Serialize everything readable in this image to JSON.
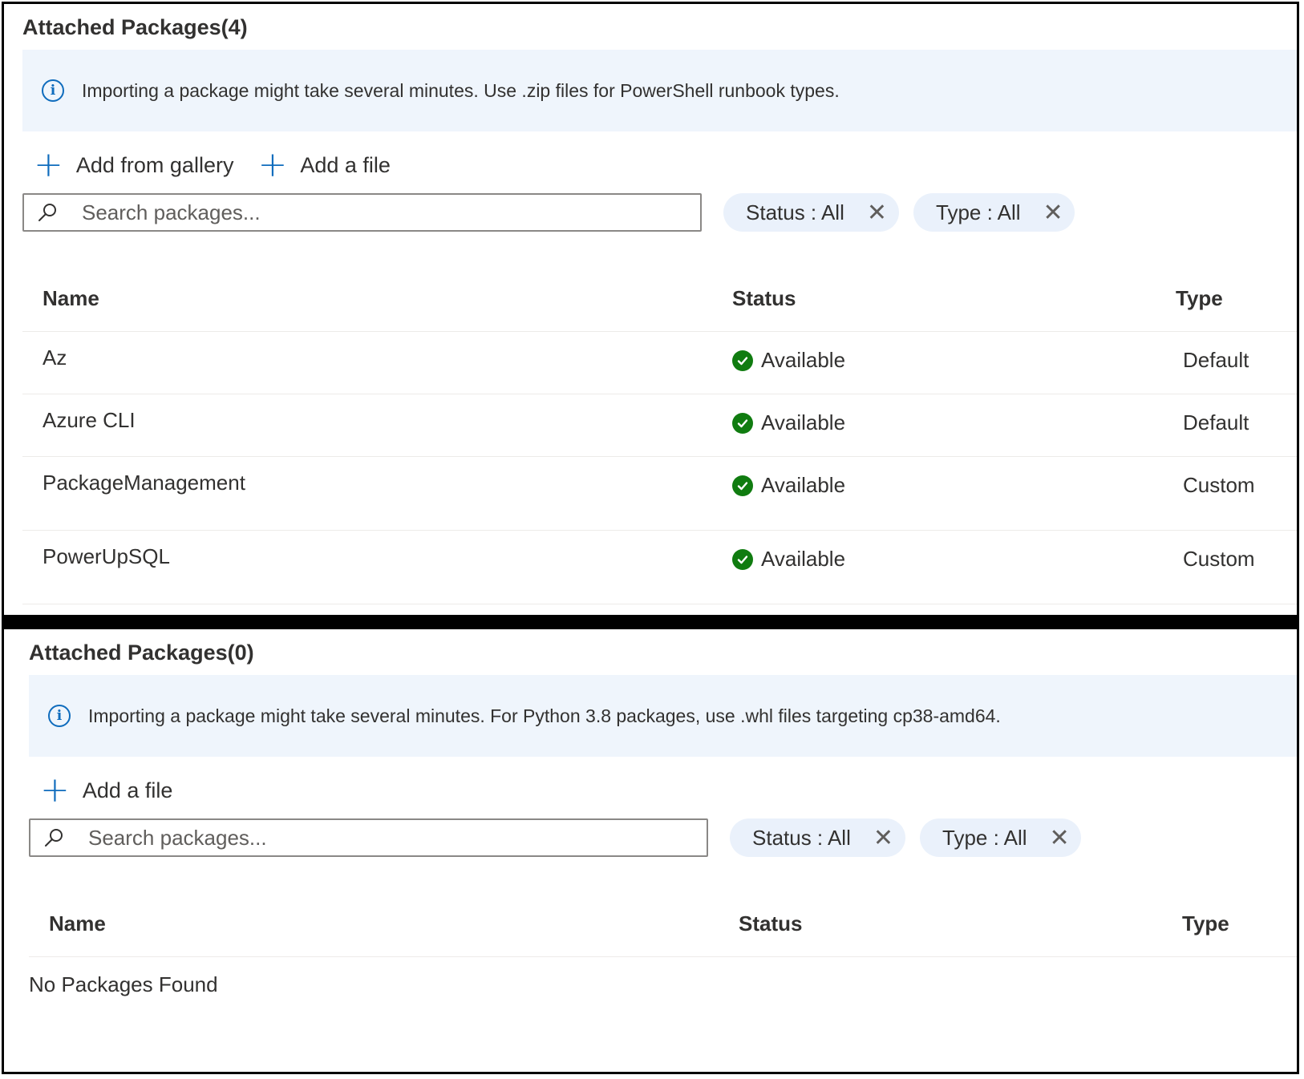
{
  "panel1": {
    "title": "Attached Packages(4)",
    "info_text": "Importing a package might take several minutes. Use .zip files for PowerShell runbook types.",
    "toolbar": {
      "add_gallery_label": "Add from gallery",
      "add_file_label": "Add a file"
    },
    "search": {
      "placeholder": "Search packages..."
    },
    "filters": {
      "status_label": "Status : All",
      "type_label": "Type : All"
    },
    "columns": {
      "name": "Name",
      "status": "Status",
      "type": "Type"
    },
    "rows": [
      {
        "name": "Az",
        "status": "Available",
        "type": "Default"
      },
      {
        "name": "Azure CLI",
        "status": "Available",
        "type": "Default"
      },
      {
        "name": "PackageManagement",
        "status": "Available",
        "type": "Custom"
      },
      {
        "name": "PowerUpSQL",
        "status": "Available",
        "type": "Custom"
      }
    ]
  },
  "panel2": {
    "title": "Attached Packages(0)",
    "info_text": "Importing a package might take several minutes. For Python 3.8 packages, use .whl files targeting cp38-amd64.",
    "toolbar": {
      "add_file_label": "Add a file"
    },
    "search": {
      "placeholder": "Search packages..."
    },
    "filters": {
      "status_label": "Status : All",
      "type_label": "Type : All"
    },
    "columns": {
      "name": "Name",
      "status": "Status",
      "type": "Type"
    },
    "empty_text": "No Packages Found"
  },
  "colors": {
    "accent": "#0f6cbd",
    "info_bg": "#eff5fc",
    "pill_bg": "#eaf1fb",
    "success": "#107c10"
  }
}
